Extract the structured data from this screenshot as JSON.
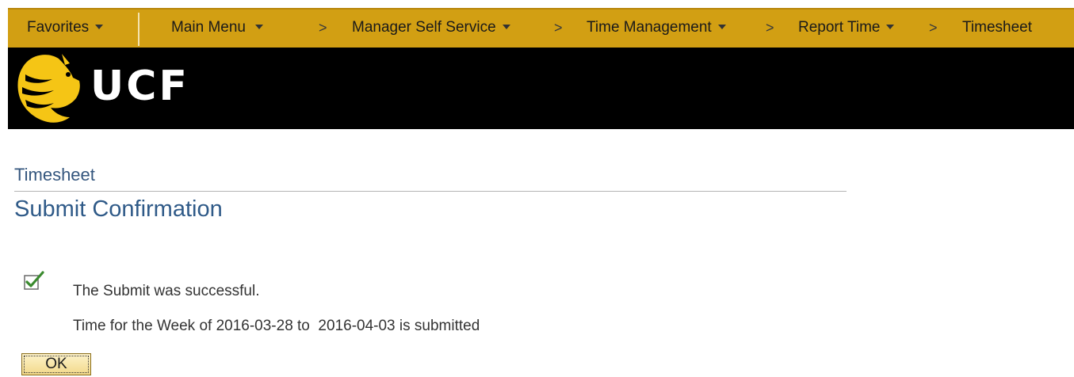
{
  "navbar": {
    "favorites": "Favorites",
    "main_menu": "Main Menu",
    "separator": ">",
    "breadcrumbs": [
      "Manager Self Service",
      "Time Management",
      "Report Time",
      "Timesheet"
    ]
  },
  "banner": {
    "logo_text": "UCF",
    "colors": {
      "background": "#000000",
      "logo_gold": "#f5c515"
    }
  },
  "content": {
    "component_title": "Timesheet",
    "page_title": "Submit Confirmation",
    "icon": "checkmark-icon",
    "message_success": "The Submit was successful.",
    "message_detail": "Time for the Week of 2016-03-28 to  2016-04-03 is submitted",
    "ok_label": "OK"
  },
  "colors": {
    "nav_bar": "#d29f13",
    "title_blue": "#2f5a88",
    "check_green": "#3a8a2e"
  }
}
